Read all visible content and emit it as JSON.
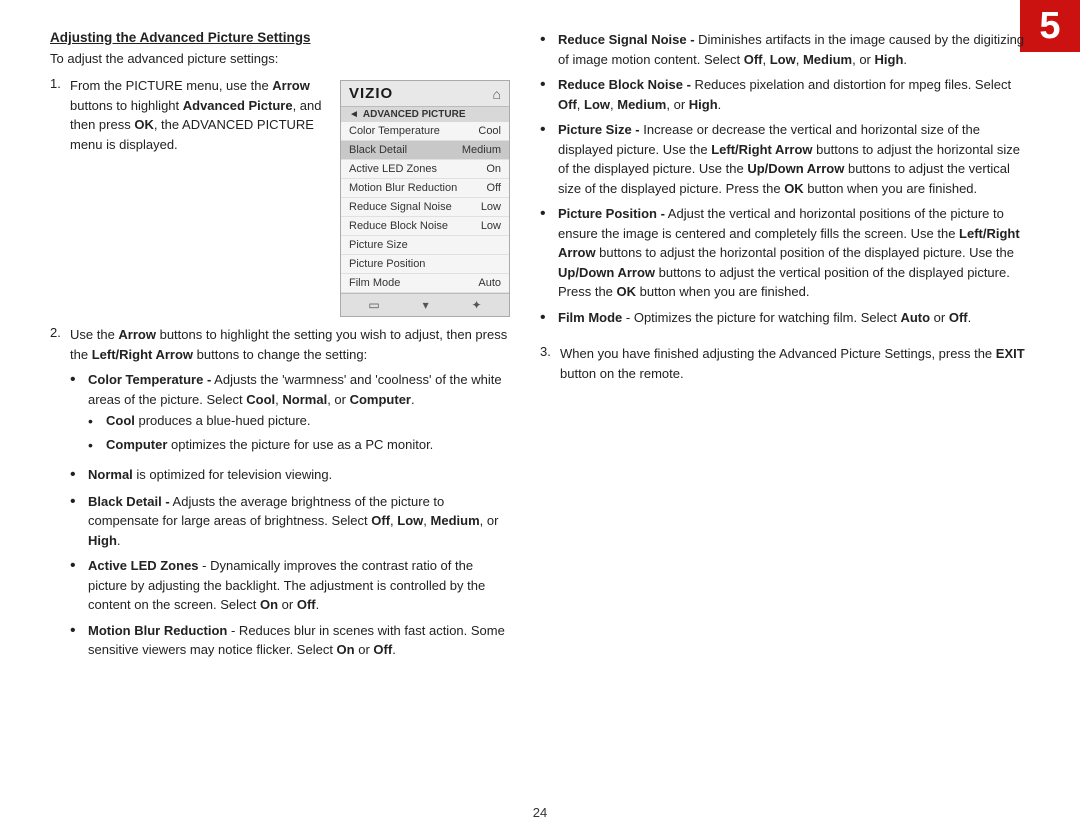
{
  "page": {
    "number": "5",
    "footer_page": "24",
    "corner_color": "#cc1111"
  },
  "heading": {
    "title": "Adjusting the Advanced Picture Settings",
    "intro": "To adjust the advanced picture settings:"
  },
  "steps": [
    {
      "num": "1.",
      "text_parts": [
        "From the PICTURE menu, use the ",
        "Arrow",
        " buttons to highlight ",
        "Advanced Picture",
        ", and then press ",
        "OK",
        ", the ADVANCED PICTURE menu is displayed."
      ]
    },
    {
      "num": "2.",
      "text_parts": [
        "Use the ",
        "Arrow",
        " buttons to highlight the setting you wish to adjust, then press the ",
        "Left/Right Arrow",
        " buttons to change the setting:"
      ]
    },
    {
      "num": "3.",
      "text": "When you have finished adjusting the Advanced Picture Settings, press the ",
      "bold": "EXIT",
      "text2": " button on the remote."
    }
  ],
  "tv_menu": {
    "logo": "VIZIO",
    "section": "ADVANCED PICTURE",
    "items": [
      {
        "label": "Color Temperature",
        "value": "Cool"
      },
      {
        "label": "Black Detail",
        "value": "Medium"
      },
      {
        "label": "Active LED Zones",
        "value": "On"
      },
      {
        "label": "Motion Blur Reduction",
        "value": "Off"
      },
      {
        "label": "Reduce Signal Noise",
        "value": "Low"
      },
      {
        "label": "Reduce Block Noise",
        "value": "Low"
      },
      {
        "label": "Picture Size",
        "value": ""
      },
      {
        "label": "Picture Position",
        "value": ""
      },
      {
        "label": "Film Mode",
        "value": "Auto"
      }
    ]
  },
  "left_bullets": [
    {
      "id": "color-temp",
      "label": "Color Temperature -",
      "text": " Adjusts the 'warmness' and 'coolness' of the white areas of the picture. Select ",
      "bold1": "Cool",
      "text2": ", ",
      "bold2": "Normal",
      "text3": ", or ",
      "bold3": "Computer",
      "text4": ".",
      "sub_items": [
        {
          "label": "Cool",
          "text": " produces a blue-hued picture."
        },
        {
          "label": "Computer",
          "text": " optimizes the picture for use as a PC monitor."
        }
      ]
    },
    {
      "id": "normal",
      "label": "Normal",
      "text": " is optimized for television viewing."
    },
    {
      "id": "black-detail",
      "label": "Black Detail -",
      "text": " Adjusts the average brightness of the picture to compensate for large areas of brightness. Select ",
      "bold1": "Off",
      "text2": ", ",
      "bold2": "Low",
      "text3": ", ",
      "bold3": "Medium",
      "text4": ", or ",
      "bold4": "High",
      "text5": "."
    },
    {
      "id": "active-led",
      "label": "Active LED Zones",
      "text": " - Dynamically improves the contrast ratio of the picture by adjusting the backlight. The adjustment is controlled by the content on the screen. Select ",
      "bold1": "On",
      "text2": " or ",
      "bold2": "Off",
      "text3": "."
    },
    {
      "id": "motion-blur",
      "label": "Motion Blur Reduction",
      "text": " - Reduces blur in scenes with fast action. Some sensitive viewers may notice flicker. Select ",
      "bold1": "On",
      "text2": " or ",
      "bold2": "Off",
      "text3": "."
    }
  ],
  "right_bullets": [
    {
      "id": "signal-noise",
      "label": "Reduce Signal Noise -",
      "text": " Diminishes artifacts in the image caused by the digitizing of image motion content. Select ",
      "bold1": "Off",
      "text2": ", ",
      "bold2": "Low",
      "text3": ", ",
      "bold3": "Medium",
      "text4": ", or ",
      "bold4": "High",
      "text5": "."
    },
    {
      "id": "block-noise",
      "label": "Reduce Block Noise -",
      "text": " Reduces pixelation and distortion for mpeg files. Select ",
      "bold1": "Off",
      "text2": ", ",
      "bold2": "Low",
      "text3": ", ",
      "bold3": "Medium",
      "text4": ", or ",
      "bold4": "High",
      "text5": "."
    },
    {
      "id": "picture-size",
      "label": "Picture Size -",
      "text": " Increase or decrease the vertical and horizontal size of the displayed picture. Use the ",
      "bold1": "Left/Right Arrow",
      "text2": " buttons to adjust the horizontal size of the displayed picture. Use the ",
      "bold2": "Up/Down Arrow",
      "text3": " buttons to adjust the vertical size of the displayed picture. Press the ",
      "bold3": "OK",
      "text4": " button when you are finished."
    },
    {
      "id": "picture-position",
      "label": "Picture Position -",
      "text": " Adjust the vertical and horizontal positions of the picture to ensure the image is centered and completely fills the screen. Use the ",
      "bold1": "Left/Right Arrow",
      "text2": " buttons to adjust the horizontal position of the displayed picture. Use the ",
      "bold2": "Up/Down Arrow",
      "text3": " buttons to adjust the vertical position of the displayed picture. Press the ",
      "bold3": "OK",
      "text4": " button when you are finished."
    },
    {
      "id": "film-mode",
      "label": "Film Mode",
      "text": " - Optimizes the picture for watching film. Select ",
      "bold1": "Auto",
      "text2": " or ",
      "bold2": "Off",
      "text3": "."
    }
  ]
}
